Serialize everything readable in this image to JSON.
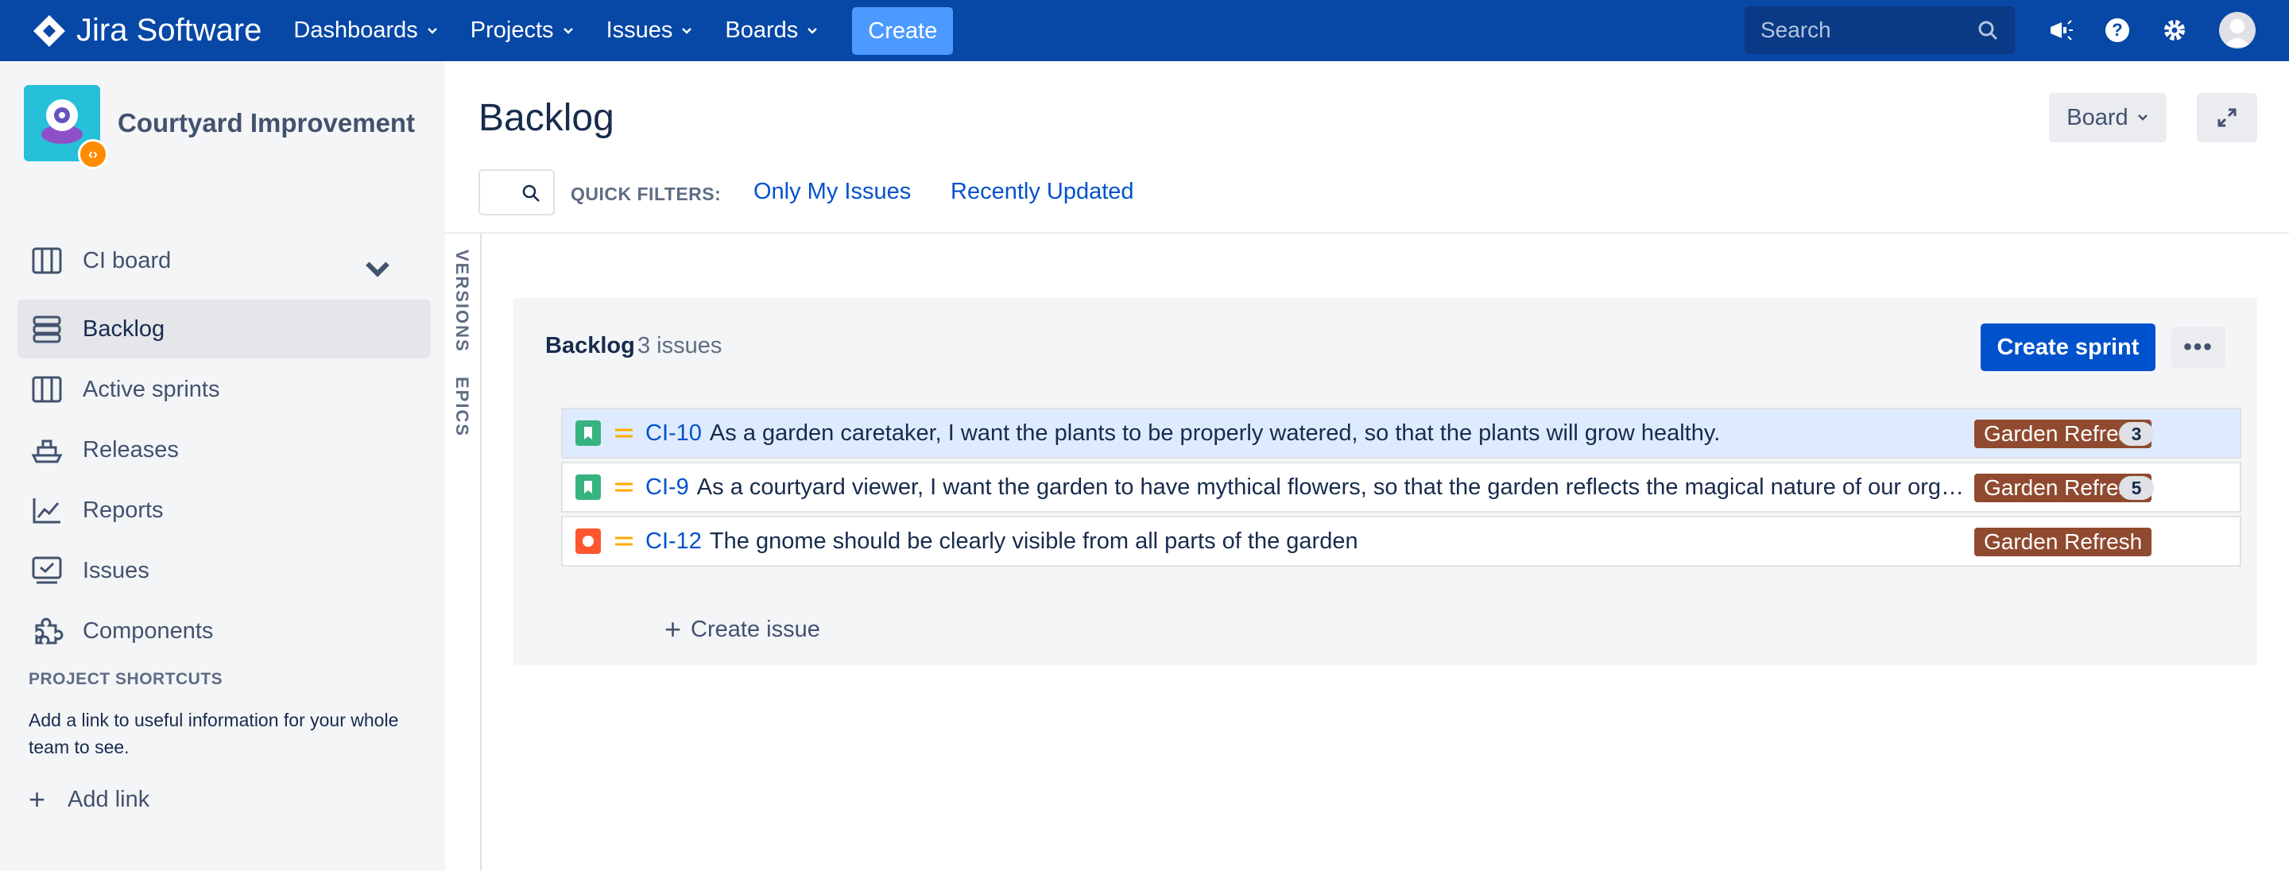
{
  "topnav": {
    "brand": "Jira Software",
    "items": [
      {
        "label": "Dashboards"
      },
      {
        "label": "Projects"
      },
      {
        "label": "Issues"
      },
      {
        "label": "Boards"
      }
    ],
    "create_label": "Create",
    "search_placeholder": "Search",
    "colors": {
      "bg": "#0747a6",
      "create": "#4c9aff"
    }
  },
  "sidebar": {
    "project_name": "Courtyard Improvement",
    "board_label": "CI board",
    "items": [
      {
        "label": "Backlog",
        "icon": "backlog-icon",
        "active": true
      },
      {
        "label": "Active sprints",
        "icon": "board-icon"
      },
      {
        "label": "Releases",
        "icon": "ship-icon"
      },
      {
        "label": "Reports",
        "icon": "chart-icon"
      },
      {
        "label": "Issues",
        "icon": "issues-icon"
      },
      {
        "label": "Components",
        "icon": "puzzle-icon"
      }
    ],
    "shortcuts_title": "PROJECT SHORTCUTS",
    "shortcuts_text": "Add a link to useful information for your whole team to see.",
    "add_link": "Add link"
  },
  "main": {
    "title": "Backlog",
    "board_button": "Board",
    "quick_filters_label": "QUICK FILTERS:",
    "quick_filters": [
      "Only My Issues",
      "Recently Updated"
    ],
    "vertical_tabs": [
      "VERSIONS",
      "EPICS"
    ]
  },
  "backlog": {
    "title": "Backlog",
    "count": "3 issues",
    "create_sprint": "Create sprint",
    "more": "•••",
    "create_issue": "Create issue",
    "issues": [
      {
        "type": "story",
        "key": "CI-10",
        "summary": "As a garden caretaker, I want the plants to be properly watered, so that the plants will grow healthy.",
        "epic": "Garden Refresh",
        "points": "3",
        "selected": true
      },
      {
        "type": "story",
        "key": "CI-9",
        "summary": "As a courtyard viewer, I want the garden to have mythical flowers, so that the garden reflects the magical nature of our organization.",
        "epic": "Garden Refresh",
        "points": "5"
      },
      {
        "type": "bug",
        "key": "CI-12",
        "summary": "The gnome should be clearly visible from all parts of the garden",
        "epic": "Garden Refresh",
        "points": ""
      }
    ],
    "colors": {
      "epic": "#8f4a2f",
      "story": "#36b37e",
      "bug": "#ff5630",
      "priority": "#ffab00"
    }
  }
}
